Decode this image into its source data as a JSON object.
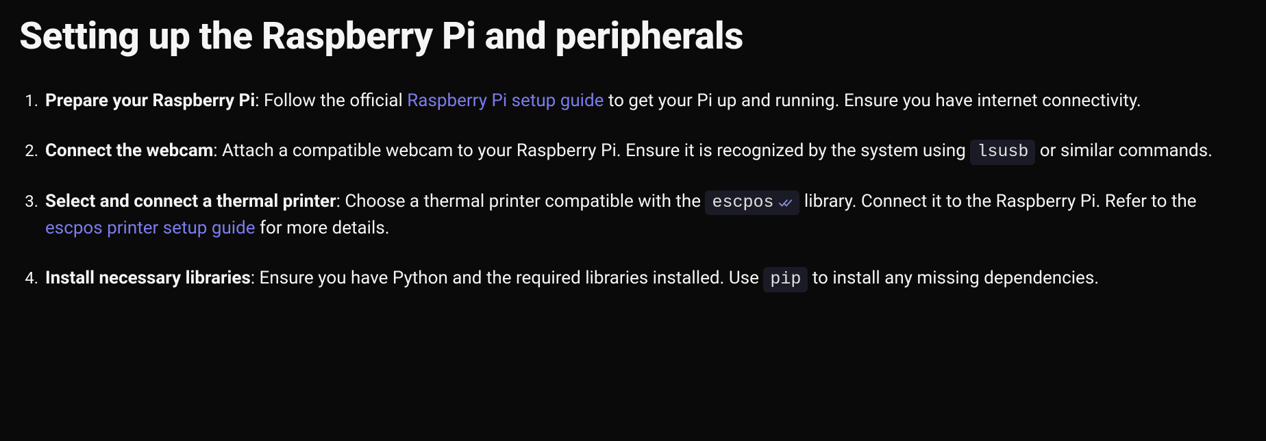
{
  "heading": "Setting up the Raspberry Pi and peripherals",
  "items": [
    {
      "bold": "Prepare your Raspberry Pi",
      "text_before_link": ": Follow the official ",
      "link": "Raspberry Pi setup guide",
      "text_after_link": " to get your Pi up and running. Ensure you have internet connectivity."
    },
    {
      "bold": "Connect the webcam",
      "text_before_code": ": Attach a compatible webcam to your Raspberry Pi. Ensure it is recognized by the system using ",
      "code": "lsusb",
      "text_after_code": " or similar commands."
    },
    {
      "bold": "Select and connect a thermal printer",
      "text_before_code": ": Choose a thermal printer compatible with the ",
      "code": "escpos",
      "text_after_code": " library. Connect it to the Raspberry Pi. Refer to the ",
      "link": "escpos printer setup guide",
      "text_after_link": " for more details."
    },
    {
      "bold": "Install necessary libraries",
      "text_before_code": ": Ensure you have Python and the required libraries installed. Use ",
      "code": "pip",
      "text_after_code": " to install any missing dependencies."
    }
  ]
}
